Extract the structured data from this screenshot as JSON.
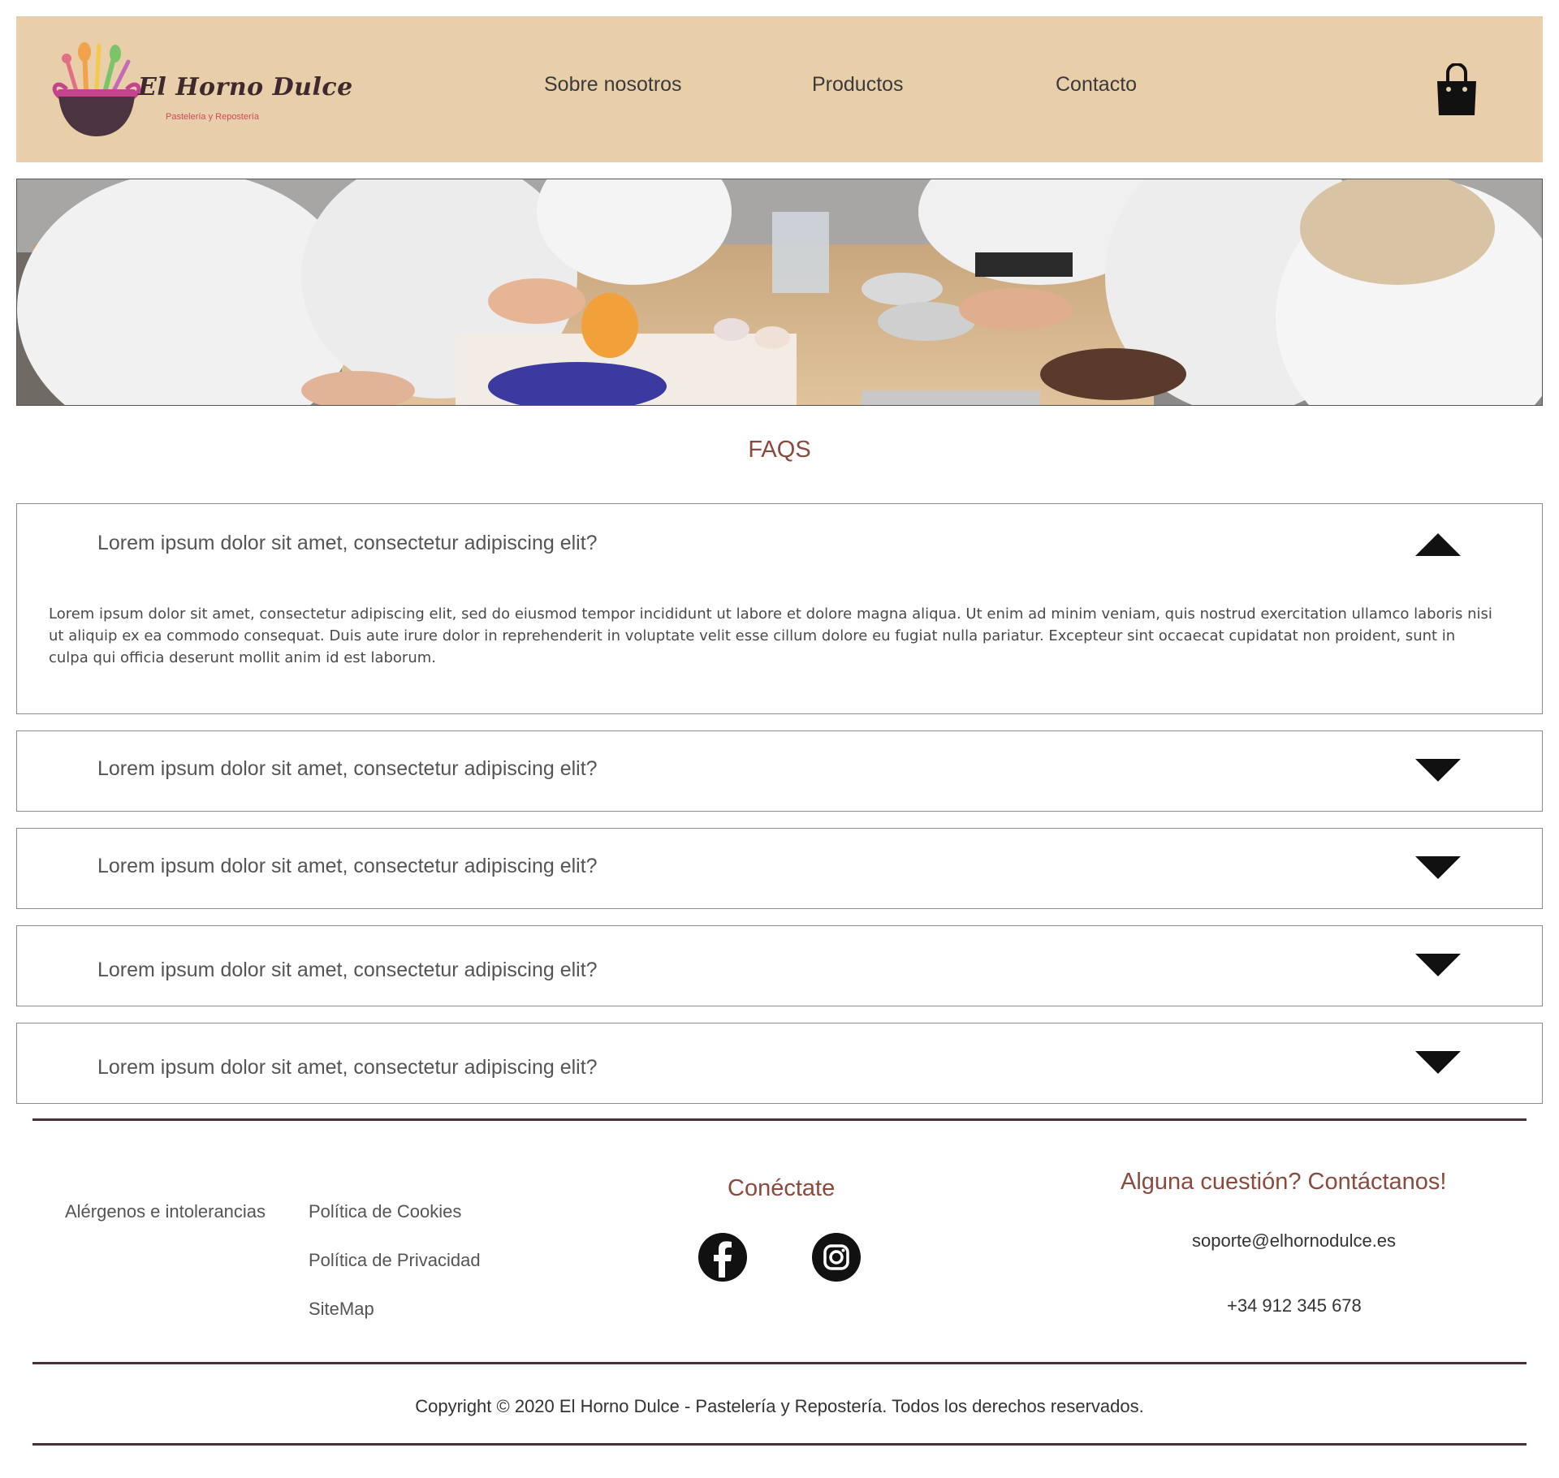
{
  "brand": {
    "name": "El Horno Dulce",
    "tagline": "Pastelería y Repostería"
  },
  "nav": {
    "items": [
      {
        "label": "Sobre nosotros"
      },
      {
        "label": "Productos"
      },
      {
        "label": "Contacto"
      }
    ],
    "cart_icon": "shopping-bag-icon"
  },
  "hero": {
    "image": "pastry-class-photo"
  },
  "faq": {
    "title": "FAQS",
    "items": [
      {
        "question": "Lorem ipsum dolor sit amet, consectetur adipiscing elit?",
        "answer": "Lorem ipsum dolor sit amet, consectetur adipiscing elit, sed do eiusmod tempor incididunt ut labore et dolore magna aliqua. Ut enim ad minim veniam, quis nostrud exercitation ullamco laboris nisi ut aliquip ex ea commodo consequat. Duis aute irure dolor in reprehenderit in voluptate velit esse cillum dolore eu fugiat nulla pariatur. Excepteur sint occaecat cupidatat non proident, sunt in culpa qui officia deserunt mollit anim id est laborum.",
        "expanded": true
      },
      {
        "question": "Lorem ipsum dolor sit amet, consectetur adipiscing elit?",
        "expanded": false
      },
      {
        "question": "Lorem ipsum dolor sit amet, consectetur adipiscing elit?",
        "expanded": false
      },
      {
        "question": "Lorem ipsum dolor sit amet, consectetur adipiscing elit?",
        "expanded": false
      },
      {
        "question": "Lorem ipsum dolor sit amet, consectetur adipiscing elit?",
        "expanded": false
      }
    ]
  },
  "footer": {
    "links": [
      {
        "label": "Alérgenos e intolerancias"
      },
      {
        "label": "Política de Cookies"
      },
      {
        "label": "Política de Privacidad"
      },
      {
        "label": "SiteMap"
      }
    ],
    "connect_heading": "Conéctate",
    "social": [
      "facebook-icon",
      "instagram-icon"
    ],
    "contact_heading": "Alguna cuestión? Contáctanos!",
    "email": "soporte@elhornodulce.es",
    "phone": "+34 912 345 678",
    "copyright": "Copyright © 2020 El Horno Dulce - Pastelería y Repostería. Todos los derechos reservados."
  },
  "colors": {
    "header_bg": "#e8cfa9",
    "accent": "#8a4a3e",
    "rule": "#4a3030"
  }
}
